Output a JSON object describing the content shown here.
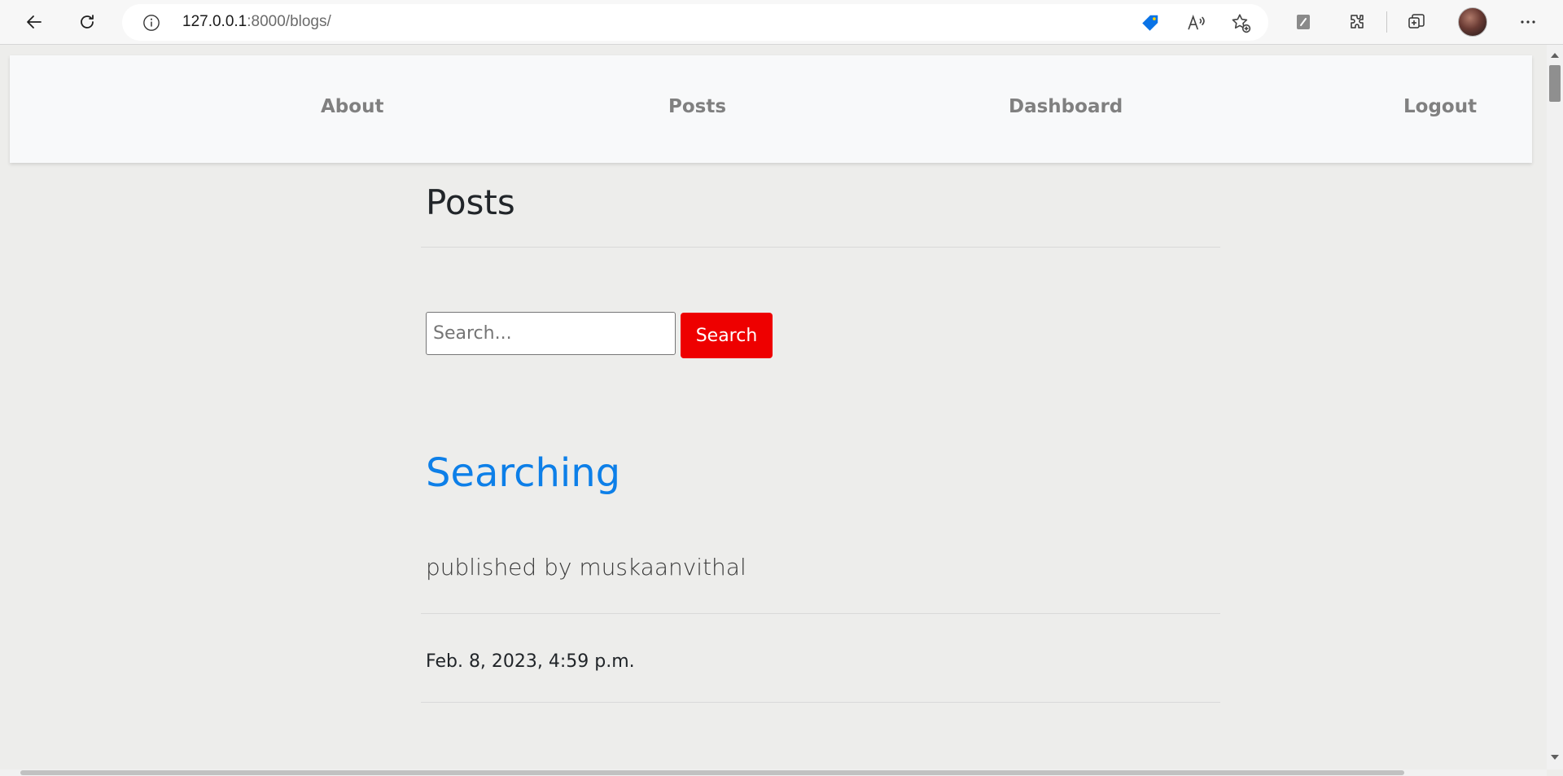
{
  "browser": {
    "url_host": "127.0.0.1",
    "url_rest": ":8000/blogs/",
    "icons": [
      "back-arrow-icon",
      "refresh-icon",
      "info-icon",
      "shopping-tag-icon",
      "read-aloud-icon",
      "add-favorite-icon",
      "notes-icon",
      "extensions-icon",
      "collections-icon",
      "profile-avatar",
      "more-menu-icon"
    ],
    "colors": {
      "tag_icon": "#0a73e6"
    }
  },
  "nav": {
    "links": [
      "About",
      "Posts",
      "Dashboard",
      "Logout"
    ]
  },
  "main": {
    "page_title": "Posts",
    "search": {
      "placeholder": "Search...",
      "value": "",
      "button_label": "Search",
      "button_color": "#ee0000"
    },
    "posts": [
      {
        "title": "Searching",
        "author": "published by muskaanvithal",
        "date": "Feb. 8, 2023, 4:59 p.m."
      }
    ]
  },
  "colors": {
    "page_background": "#ededeb",
    "navbar_background": "#f8f9fa",
    "link_color": "#0d7fe8",
    "nav_link_color": "#808080"
  }
}
